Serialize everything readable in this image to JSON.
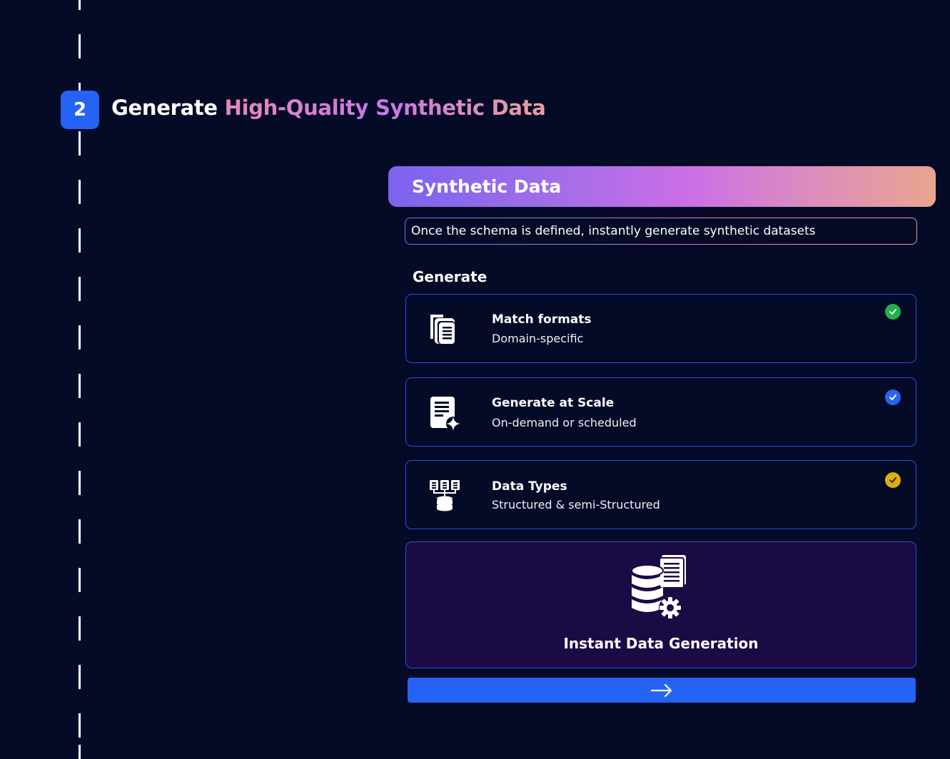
{
  "step": {
    "number": "2",
    "heading_plain": "Generate",
    "heading_accent": "High-Quality Synthetic Data"
  },
  "panel": {
    "banner_title": "Synthetic Data",
    "tagline": "Once the schema is defined, instantly generate synthetic datasets",
    "section_label": "Generate",
    "features": [
      {
        "title": "Match formats",
        "subtitle": "Domain-specific",
        "icon": "documents-icon",
        "check_color": "#22b04b"
      },
      {
        "title": "Generate at Scale",
        "subtitle": "On-demand or scheduled",
        "icon": "document-sparkle-icon",
        "check_color": "#2a63f0"
      },
      {
        "title": "Data Types",
        "subtitle": "Structured & semi-Structured",
        "icon": "data-structure-icon",
        "check_color": "#dcae12"
      }
    ],
    "highlight": {
      "title": "Instant Data Generation",
      "icon": "database-gear-icon"
    },
    "next_button": {
      "icon": "arrow-right-icon"
    }
  },
  "colors": {
    "background": "#050a26",
    "accent_blue": "#2563f5",
    "card_border": "#2553e6",
    "highlight_bg": "#1a0b45"
  }
}
